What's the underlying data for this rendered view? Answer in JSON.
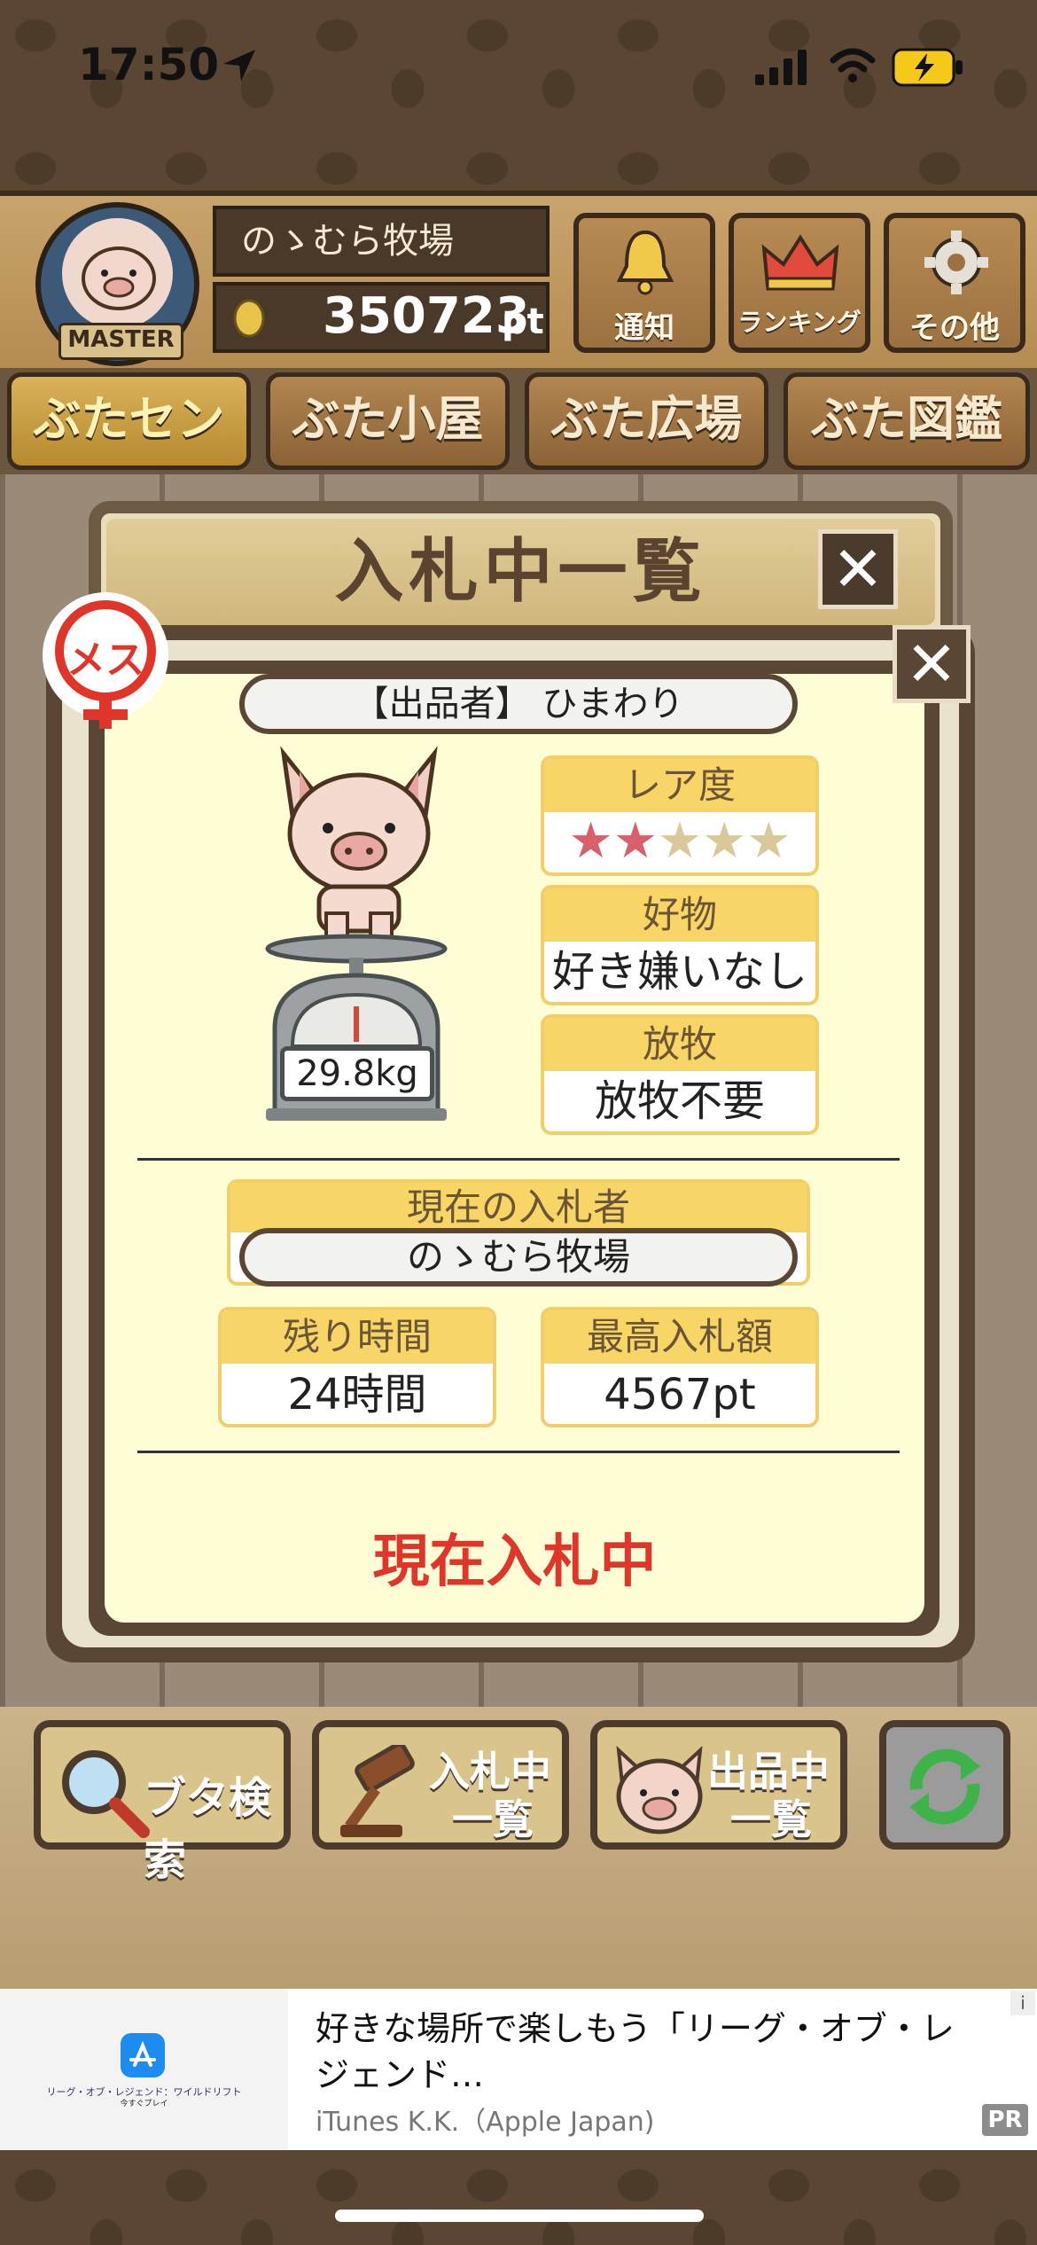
{
  "status_bar": {
    "time": "17:50"
  },
  "header": {
    "badge_text": "MASTER",
    "farm_name": "のゝむら牧場",
    "points": "350723",
    "points_unit": "pt",
    "buttons": [
      {
        "label": "通知",
        "icon": "bell-icon"
      },
      {
        "label": "ランキング",
        "icon": "crown-icon"
      },
      {
        "label": "その他",
        "icon": "gear-icon"
      }
    ]
  },
  "nav": {
    "tabs": [
      "ぶたセンター",
      "ぶた小屋",
      "ぶた広場",
      "ぶた図鑑"
    ],
    "active": 0
  },
  "list_panel": {
    "title": "入札中一覧",
    "close": "✕"
  },
  "card": {
    "gender_badge": "メス",
    "close": "✕",
    "seller": "【出品者】 ひまわり",
    "weight": "29.8kg",
    "rarity": {
      "label": "レア度",
      "filled": 2,
      "total": 5
    },
    "favorite": {
      "label": "好物",
      "value": "好き嫌いなし"
    },
    "grazing": {
      "label": "放牧",
      "value": "放牧不要"
    },
    "current_bidder": {
      "label": "現在の入札者",
      "value": "のゝむら牧場"
    },
    "time_left": {
      "label": "残り時間",
      "value": "24時間"
    },
    "highest_bid": {
      "label": "最高入札額",
      "value": "4567pt"
    },
    "status": "現在入札中"
  },
  "toolbar": {
    "search_label": "ブタ検索",
    "bidding_label_1": "入札中",
    "bidding_label_2": "一覧",
    "listing_label_1": "出品中",
    "listing_label_2": "一覧"
  },
  "ad": {
    "app_caption": "リーグ・オブ・レジェンド：ワイルドリフト",
    "app_sub": "今すぐプレイ",
    "title": "好きな場所で楽しもう「リーグ・オブ・レジェンド…",
    "advertiser": "iTunes K.K.（Apple Japan)",
    "pr": "PR",
    "info": "i"
  },
  "colors": {
    "accent_red": "#e0362a",
    "star_pink": "#d9606a",
    "star_empty": "#d8c89a"
  }
}
